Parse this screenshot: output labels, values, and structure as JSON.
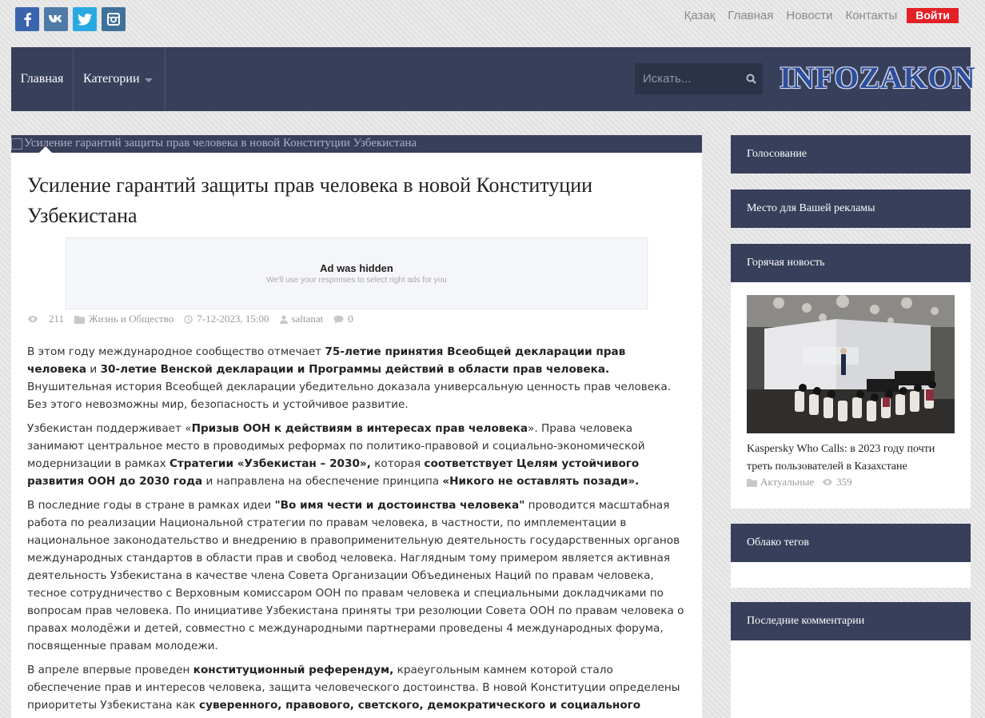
{
  "social": {
    "facebook": "facebook-icon",
    "vk": "vk-icon",
    "twitter": "twitter-icon",
    "instagram": "instagram-icon"
  },
  "top_links": {
    "kazakh": "Қазақ",
    "home": "Главная",
    "news": "Новости",
    "contacts": "Контакты",
    "login": "Войти"
  },
  "nav": {
    "home": "Главная",
    "categories": "Категории",
    "search_placeholder": "Искать...",
    "logo": "INFOZAKON"
  },
  "article": {
    "image_alt": "Усиление гарантий защиты прав человека в новой Конституции Узбекистана",
    "title": "Усиление гарантий защиты прав человека в новой Конституции Узбекистана",
    "ad": {
      "heading": "Ad was hidden",
      "subtext": "We'll use your responses to select right ads for you"
    },
    "meta": {
      "views": "211",
      "category": "Жизнь и Общество",
      "date": "7-12-2023, 15:00",
      "author": "saltanat",
      "comments": "0"
    },
    "paragraphs": [
      [
        {
          "t": "В этом году международное сообщество отмечает "
        },
        {
          "t": "75-летие принятия Всеобщей декларации прав человека",
          "b": true
        },
        {
          "t": " и "
        },
        {
          "t": "30-летие Венской декларации и Программы действий в области прав человека.",
          "b": true
        },
        {
          "t": " Внушительная история Всеобщей декларации убедительно доказала универсальную ценность прав человека. Без этого невозможны мир, безопасность и устойчивое развитие."
        }
      ],
      [
        {
          "t": "Узбекистан поддерживает «"
        },
        {
          "t": "Призыв ООН к действиям в интересах прав человека",
          "b": true
        },
        {
          "t": "». Права человека занимают центральное место в проводимых реформах по политико-правовой и социально-экономической модернизации в рамках "
        },
        {
          "t": "Стратегии «Узбекистан – 2030»,",
          "b": true
        },
        {
          "t": " которая "
        },
        {
          "t": "соответствует Целям устойчивого развития ООН до 2030 года",
          "b": true
        },
        {
          "t": " и направлена на обеспечение принципа "
        },
        {
          "t": "«Никого не оставлять позади».",
          "b": true
        }
      ],
      [
        {
          "t": "В последние годы в стране в рамках идеи "
        },
        {
          "t": "\"Во имя чести и достоинства человека\"",
          "b": true
        },
        {
          "t": " проводится масштабная работа по реализации Национальной стратегии по правам человека,  в частности, по имплементации в национальное законодательство и внедрению в правоприменительную деятельность государственных органов международных стандартов в области прав и свобод человека. Наглядным тому примером является активная деятельность Узбекистана в качестве члена Совета Организации Объединеных Наций по правам человека, тесное сотрудничество с Верховным комиссаром ООН по правам человека и специальными докладчиками по вопросам прав человека. По инициативе Узбекистана приняты три резолюции Совета ООН по правам человека о правах молодёжи и детей, совместно с международными партнерами проведены 4 международных форума, посвященные правам молодежи."
        }
      ],
      [
        {
          "t": "В апреле впервые проведен "
        },
        {
          "t": "конституционный референдум,",
          "b": true
        },
        {
          "t": " краеугольным камнем которой стало обеспечение прав и интересов человека, защита человеческого достоинства. В новой Конституции определены приоритеты Узбекистана как "
        },
        {
          "t": "суверенного, правового, светского, демократического и социального государства.",
          "b": true
        }
      ]
    ]
  },
  "sidebar": {
    "voting": "Голосование",
    "ads": "Место для Вашей рекламы",
    "hot_news": {
      "heading": "Горячая новость",
      "title": "Kaspersky Who Calls: в 2023 году почти треть пользователей в Казахстане",
      "category": "Актуальные",
      "views": "359"
    },
    "tags": "Облако тегов",
    "comments": "Последние комментарии"
  },
  "colors": {
    "nav_bg": "#373f5a",
    "login_red": "#e42027",
    "logo_blue": "#2f4e9a"
  }
}
